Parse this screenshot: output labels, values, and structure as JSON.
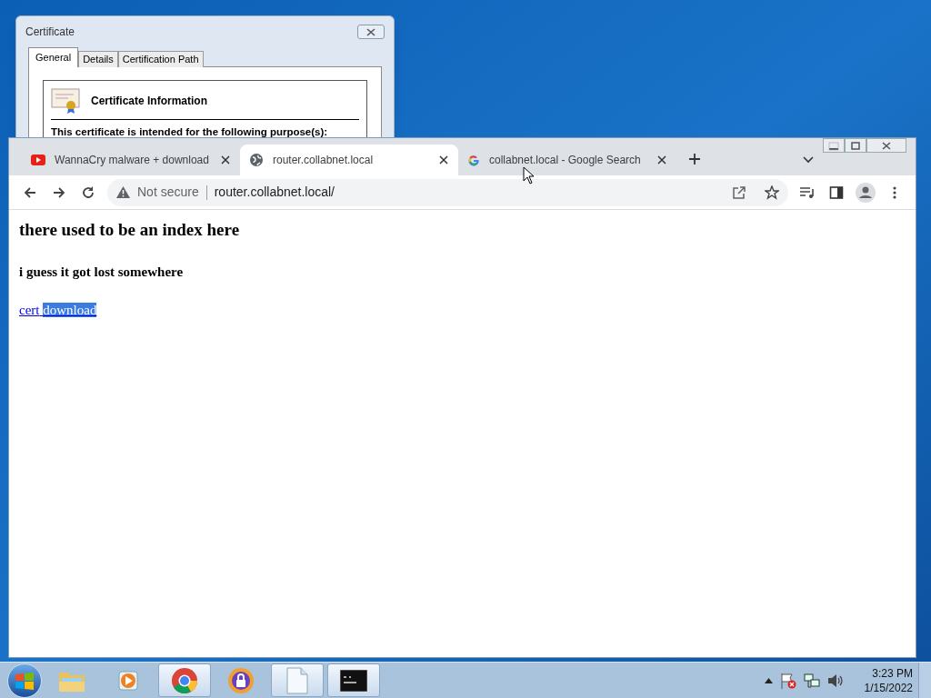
{
  "certificate_dialog": {
    "title": "Certificate",
    "tabs": [
      {
        "label": "General",
        "selected": true
      },
      {
        "label": "Details",
        "selected": false
      },
      {
        "label": "Certification Path",
        "selected": false
      }
    ],
    "heading": "Certificate Information",
    "purpose_text": "This certificate is intended for the following purpose(s):"
  },
  "browser": {
    "tabs": [
      {
        "title": "WannaCry malware + download",
        "kind": "video",
        "selected": false
      },
      {
        "title": "router.collabnet.local",
        "kind": "globe",
        "selected": true
      },
      {
        "title": "collabnet.local - Google Search",
        "kind": "google",
        "selected": false
      }
    ],
    "security_label": "Not secure",
    "url": "router.collabnet.local/",
    "page": {
      "heading": "there used to be an index here",
      "subheading": "i guess it got lost somewhere",
      "link_parts": [
        {
          "text": "cert",
          "selected": false
        },
        {
          "text": "download",
          "selected": true
        }
      ]
    }
  },
  "taskbar": {
    "apps": [
      {
        "kind": "folder",
        "selected": false
      },
      {
        "kind": "media",
        "selected": false
      },
      {
        "kind": "chrome",
        "selected": true
      },
      {
        "kind": "vault",
        "selected": false
      },
      {
        "kind": "document",
        "selected": true
      },
      {
        "kind": "terminal",
        "selected": true
      }
    ],
    "time": "3:23 PM",
    "date": "1/15/2022"
  }
}
